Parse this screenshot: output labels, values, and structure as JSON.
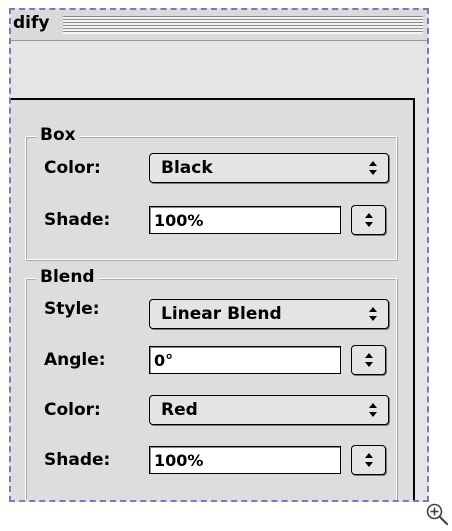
{
  "window": {
    "title": "dify"
  },
  "box": {
    "title": "Box",
    "color_label": "Color:",
    "color_value": "Black",
    "shade_label": "Shade:",
    "shade_value": "100%"
  },
  "blend": {
    "title": "Blend",
    "style_label": "Style:",
    "style_value": "Linear Blend",
    "angle_label": "Angle:",
    "angle_value": "0°",
    "color_label": "Color:",
    "color_value": "Red",
    "shade_label": "Shade:",
    "shade_value": "100%"
  },
  "icons": {
    "popup_arrows": "updown-arrows-icon",
    "zoom": "zoom-in-icon"
  }
}
